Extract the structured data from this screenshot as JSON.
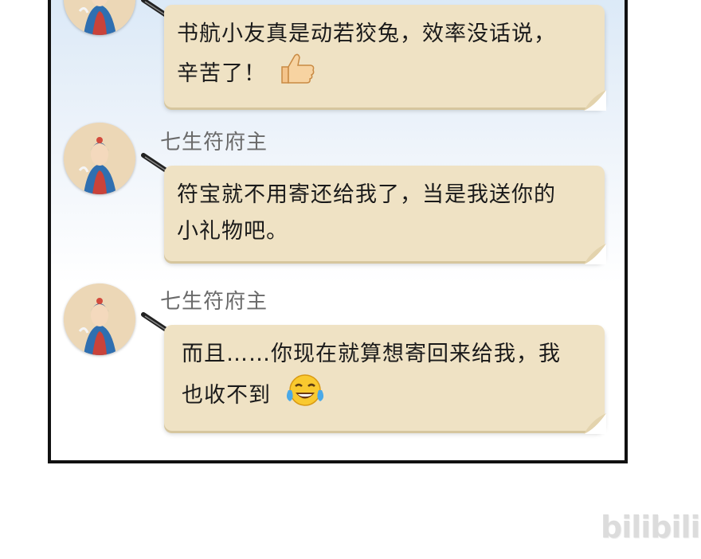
{
  "messages": [
    {
      "sender": "",
      "lines": [
        "书航小友真是动若狡兔，效率没话说，",
        "辛苦了！"
      ],
      "emoji": "thumbs-up-emoji"
    },
    {
      "sender": "七生符府主",
      "lines": [
        "符宝就不用寄还给我了，当是我送你的",
        "小礼物吧。"
      ],
      "emoji": ""
    },
    {
      "sender": "七生符府主",
      "lines": [
        "而且……你现在就算想寄回来给我，我",
        "也收不到"
      ],
      "emoji": "tears-of-joy-emoji"
    }
  ],
  "watermark": "bilibili",
  "colors": {
    "bubble": "#efe2c4",
    "bubble_shadow": "#d6c69e",
    "panel_top": "#dbe9f7",
    "sender": "#6a6a6a",
    "border": "#111111"
  }
}
